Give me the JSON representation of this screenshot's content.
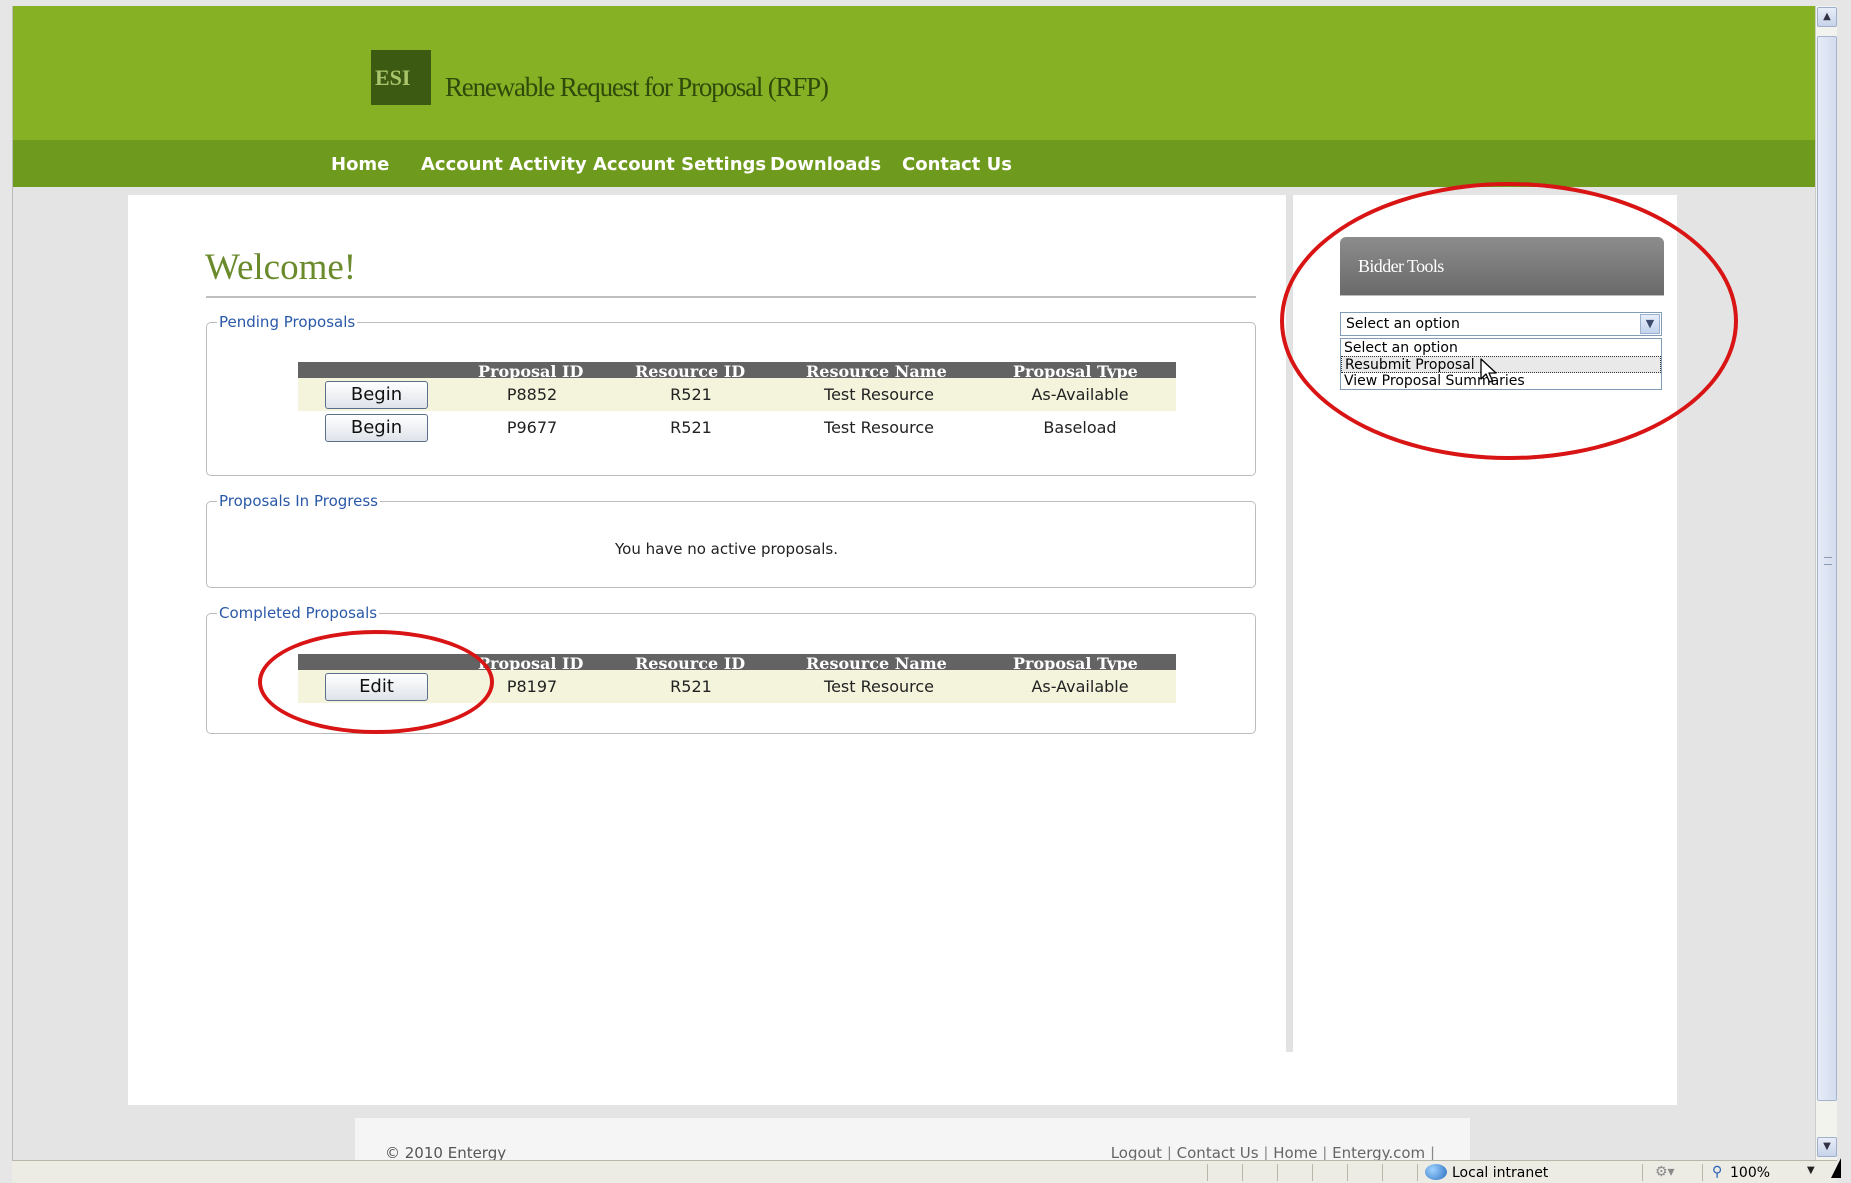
{
  "header": {
    "logo_text": "ESI",
    "site_title": "Renewable Request for Proposal (RFP)"
  },
  "nav": {
    "items": [
      {
        "label": "Home"
      },
      {
        "label": "Account Activity"
      },
      {
        "label": "Account Settings"
      },
      {
        "label": "Downloads"
      },
      {
        "label": "Contact Us"
      }
    ]
  },
  "main": {
    "welcome": "Welcome!",
    "columns": [
      "Proposal ID",
      "Resource ID",
      "Resource Name",
      "Proposal Type"
    ],
    "pending": {
      "title": "Pending Proposals",
      "rows": [
        {
          "action": "Begin",
          "proposal_id": "P8852",
          "resource_id": "R521",
          "resource_name": "Test Resource",
          "proposal_type": "As-Available"
        },
        {
          "action": "Begin",
          "proposal_id": "P9677",
          "resource_id": "R521",
          "resource_name": "Test Resource",
          "proposal_type": "Baseload"
        }
      ]
    },
    "in_progress": {
      "title": "Proposals In Progress",
      "empty_message": "You have no active proposals."
    },
    "completed": {
      "title": "Completed Proposals",
      "rows": [
        {
          "action": "Edit",
          "proposal_id": "P8197",
          "resource_id": "R521",
          "resource_name": "Test Resource",
          "proposal_type": "As-Available"
        }
      ]
    }
  },
  "sidebar": {
    "tools_title": "Bidder Tools",
    "select_value": "Select an option",
    "options": [
      "Select an option",
      "Resubmit Proposal",
      "View Proposal Summaries"
    ]
  },
  "footer": {
    "copyright": "© 2010 Entergy",
    "links": [
      "Logout",
      "Contact Us",
      "Home",
      "Entergy.com"
    ]
  },
  "statusbar": {
    "zone": "Local intranet",
    "zoom": "100%"
  },
  "icons": {
    "dropdown": "chevron-down-icon",
    "cursor": "mouse-pointer-icon",
    "zone": "globe-icon",
    "zoom": "magnifier-icon"
  },
  "colors": {
    "banner": "#87b125",
    "navbar": "#6e9a1d",
    "annotation": "#d81414",
    "legend_text": "#2a58a8"
  }
}
